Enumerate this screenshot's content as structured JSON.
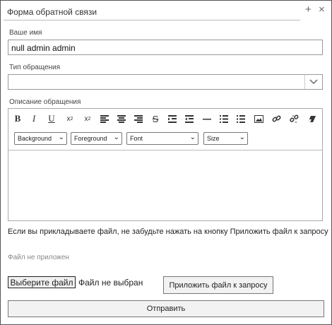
{
  "window": {
    "title": "Форма обратной связи",
    "pin_icon": "plus-icon",
    "close_icon": "close-icon"
  },
  "form": {
    "name_label": "Ваше имя",
    "name_value": "null admin admin",
    "type_label": "Тип обращения",
    "type_value": "",
    "description_label": "Описание обращения"
  },
  "editor": {
    "tools": [
      "bold",
      "italic",
      "underline",
      "subscript",
      "superscript",
      "align-left",
      "align-center",
      "align-right",
      "strikethrough",
      "indent",
      "outdent",
      "horizontal-rule",
      "ordered-list",
      "unordered-list",
      "image",
      "link",
      "unlink",
      "eraser"
    ],
    "background_label": "Background",
    "foreground_label": "Foreground",
    "font_label": "Font",
    "size_label": "Size",
    "content": ""
  },
  "attachment": {
    "hint": "Если вы прикладываете файл, не забудьте нажать на кнопку Приложить файл к запросу",
    "status": "Файл не приложен",
    "choose_button": "Выберите файл",
    "no_file_text": "Файл не выбран",
    "attach_button": "Приложить файл к запросу"
  },
  "submit_button": "Отправить"
}
